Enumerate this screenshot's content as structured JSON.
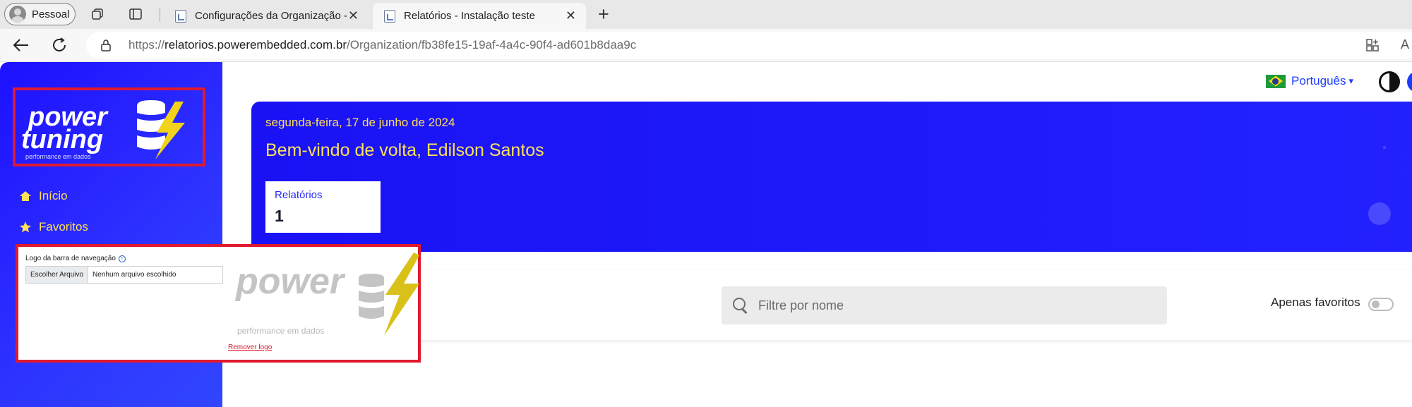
{
  "browser": {
    "profile_label": "Pessoal",
    "tabs": [
      {
        "title": "Configurações da Organização -",
        "active": false
      },
      {
        "title": "Relatórios - Instalação teste",
        "active": true
      }
    ],
    "new_tab_symbol": "+",
    "close_symbol": "✕",
    "url": {
      "scheme": "https://",
      "host": "relatorios.powerembedded.com.br",
      "path": "/Organization/fb38fe15-19af-4a4c-90f4-ad601b8daa9c"
    }
  },
  "sidebar": {
    "logo": {
      "line1": "power",
      "line2": "tuning",
      "tagline": "performance em dados"
    },
    "items": [
      {
        "label": "Início",
        "icon": "home-icon"
      },
      {
        "label": "Favoritos",
        "icon": "star-icon"
      }
    ]
  },
  "header": {
    "language": "Português",
    "language_caret": "▾"
  },
  "banner": {
    "date": "segunda-feira, 17 de junho de 2024",
    "welcome": "Bem-vindo de volta, Edilson Santos",
    "stat": {
      "label": "Relatórios",
      "value": "1"
    }
  },
  "filters": {
    "search_placeholder": "Filtre por nome",
    "favorites_only_label": "Apenas favoritos",
    "favorites_only": false
  },
  "overlay": {
    "field_label": "Logo da barra de navegação",
    "info_symbol": "i",
    "choose_file": "Escolher Arquivo",
    "no_file": "Nenhum arquivo escolhido",
    "logo_word": "power",
    "tagline": "performance em dados",
    "remove_logo": "Remover logo"
  },
  "colors": {
    "primary_blue": "#1d10ff",
    "accent_yellow": "#ffe15a",
    "highlight_red": "#e01a2e"
  }
}
